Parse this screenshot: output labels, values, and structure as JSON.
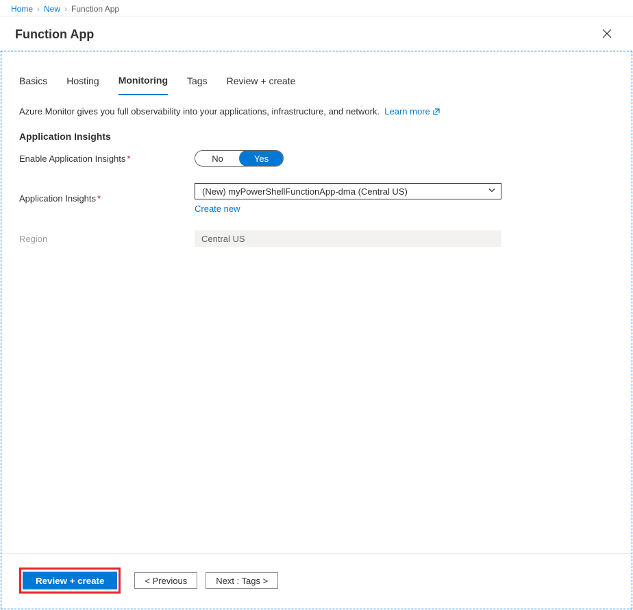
{
  "breadcrumb": {
    "home": "Home",
    "new": "New",
    "current": "Function App"
  },
  "title": "Function App",
  "tabs": {
    "basics": "Basics",
    "hosting": "Hosting",
    "monitoring": "Monitoring",
    "tags": "Tags",
    "review": "Review + create",
    "active": "monitoring"
  },
  "intro": {
    "text": "Azure Monitor gives you full observability into your applications, infrastructure, and network.",
    "link": "Learn more"
  },
  "section": {
    "title": "Application Insights",
    "enable_label": "Enable Application Insights",
    "enable_no": "No",
    "enable_yes": "Yes",
    "enable_value": "Yes",
    "insights_label": "Application Insights",
    "insights_value": "(New) myPowerShellFunctionApp-dma (Central US)",
    "create_new": "Create new",
    "region_label": "Region",
    "region_value": "Central US"
  },
  "footer": {
    "review_create": "Review + create",
    "previous": "< Previous",
    "next": "Next : Tags >"
  }
}
